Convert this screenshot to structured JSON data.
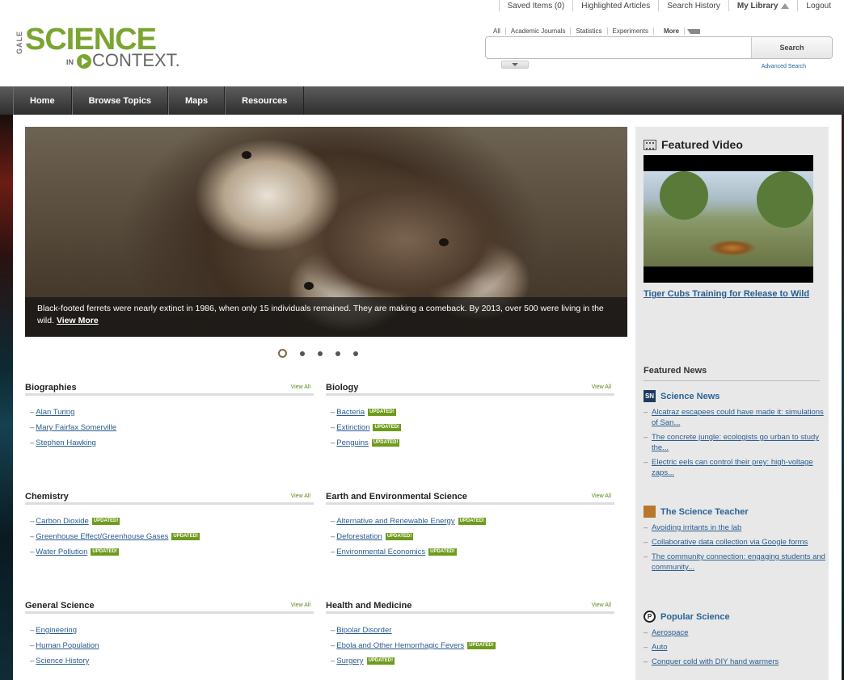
{
  "utility": {
    "saved_items": "Saved Items (0)",
    "highlighted": "Highlighted Articles",
    "history": "Search History",
    "library": "My Library",
    "logout": "Logout"
  },
  "logo": {
    "gale": "GALE",
    "science": "SCIENCE",
    "in": "IN",
    "context": "CONTEXT."
  },
  "search": {
    "tabs": [
      "All",
      "Academic Journals",
      "Statistics",
      "Experiments",
      "More"
    ],
    "placeholder": "",
    "button": "Search",
    "advanced": "Advanced Search"
  },
  "nav": [
    "Home",
    "Browse Topics",
    "Maps",
    "Resources"
  ],
  "hero": {
    "caption": "Black-footed ferrets were nearly extinct in 1986, when only 15 individuals remained. They are making a comeback. By 2013, over 500 were living in the wild.",
    "link": "View More",
    "slides": 5,
    "active_slide": 1
  },
  "sections": [
    {
      "title": "Biographies",
      "view_all": "View All",
      "items": [
        {
          "label": "Alan Turing",
          "updated": false
        },
        {
          "label": "Mary Fairfax Somerville",
          "updated": false
        },
        {
          "label": "Stephen Hawking",
          "updated": false
        }
      ]
    },
    {
      "title": "Biology",
      "view_all": "View All",
      "items": [
        {
          "label": "Bacteria",
          "updated": true
        },
        {
          "label": "Extinction",
          "updated": true
        },
        {
          "label": "Penguins",
          "updated": true
        }
      ]
    },
    {
      "title": "Chemistry",
      "view_all": "View All",
      "items": [
        {
          "label": "Carbon Dioxide",
          "updated": true
        },
        {
          "label": "Greenhouse Effect/Greenhouse Gases",
          "updated": true
        },
        {
          "label": "Water Pollution",
          "updated": true
        }
      ]
    },
    {
      "title": "Earth and Environmental Science",
      "view_all": "View All",
      "items": [
        {
          "label": "Alternative and Renewable Energy",
          "updated": true
        },
        {
          "label": "Deforestation",
          "updated": true
        },
        {
          "label": "Environmental Economics",
          "updated": true
        }
      ]
    },
    {
      "title": "General Science",
      "view_all": "View All",
      "items": [
        {
          "label": "Engineering",
          "updated": false
        },
        {
          "label": "Human Population",
          "updated": false
        },
        {
          "label": "Science History",
          "updated": false
        }
      ]
    },
    {
      "title": "Health and Medicine",
      "view_all": "View All",
      "items": [
        {
          "label": "Bipolar Disorder",
          "updated": false
        },
        {
          "label": "Ebola and Other Hemorrhagic Fevers",
          "updated": true
        },
        {
          "label": "Surgery",
          "updated": true
        }
      ]
    }
  ],
  "badge_text": "UPDATED!",
  "featured_video": {
    "title": "Featured Video",
    "link": "Tiger Cubs Training for Release to Wild"
  },
  "featured_news": {
    "title": "Featured News",
    "sources": [
      {
        "name": "Science News",
        "icon": "SN",
        "items": [
          "Alcatraz escapees could have made it: simulations of San...",
          "The concrete jungle: ecologists go urban to study the...",
          "Electric eels can control their prey: high-voltage zaps..."
        ]
      },
      {
        "name": "The Science Teacher",
        "icon": "",
        "items": [
          "Avoiding irritants in the lab",
          "Collaborative data collection via Google forms",
          "The community connection: engaging students and community..."
        ]
      },
      {
        "name": "Popular Science",
        "icon": "P",
        "items": [
          "Aerospace",
          "Auto",
          "Conquer cold with DIY hand warmers"
        ]
      }
    ]
  },
  "colors": {
    "brand_green": "#7aa531",
    "link_blue": "#2a5d8f",
    "nav_dark": "#3a3a3a"
  }
}
